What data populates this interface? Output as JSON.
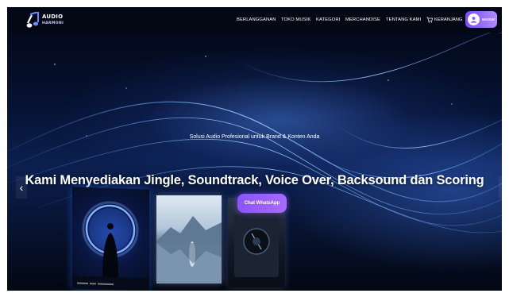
{
  "brand": {
    "name_line1": "AUDIO",
    "name_line2": "HARMONI",
    "accent": "#8a54ff"
  },
  "nav": {
    "items": [
      {
        "label": "BERLANGGANAN",
        "name": "nav-berlangganan"
      },
      {
        "label": "TOKO MUSIK",
        "name": "nav-toko-musik"
      },
      {
        "label": "KATEGORI",
        "name": "nav-kategori"
      },
      {
        "label": "MERCHANDISE",
        "name": "nav-merchandise"
      },
      {
        "label": "TENTANG KAMI",
        "name": "nav-tentang-kami"
      }
    ],
    "cart_label": "KERANJANG",
    "cart_icon": "cart-icon",
    "login_label": "MASUK",
    "login_icon": "user-icon"
  },
  "hero": {
    "subtitle": "Solusi Audio Profesional untuk Brand & Konten Anda",
    "headline": "Kami Menyediakan Jingle, Soundtrack, Voice Over, Backsound dan Scoring",
    "cta_label": "Chat WhatsApp",
    "prev_icon": "chevron-left-icon",
    "next_icon": "chevron-right-icon",
    "prev_glyph": "‹",
    "next_glyph": "›"
  },
  "colors": {
    "background": "#061233",
    "cta": "#8a54ff",
    "text": "#ffffff"
  }
}
